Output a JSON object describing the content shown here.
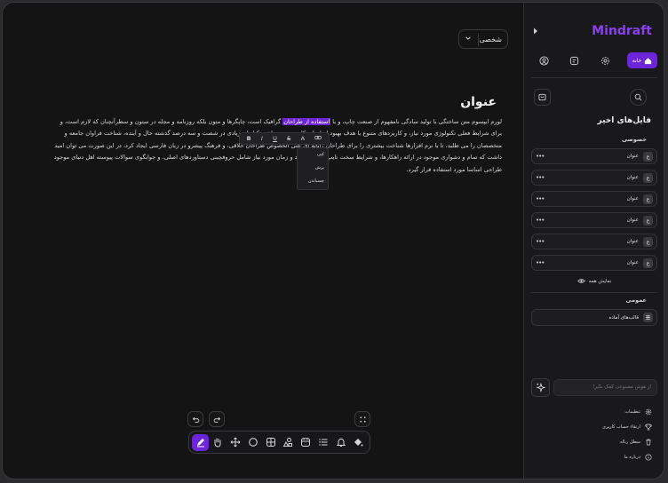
{
  "header": {
    "workspace_label": "شخصی"
  },
  "document": {
    "title": "عنوان",
    "body_before": "لورم ایپسوم متن ساختگی با تولید سادگی نامفهوم از صنعت چاپ، و با ",
    "body_highlight": "استفاده از طراحان",
    "body_after": " گرافیک است، چاپگرها و متون بلکه روزنامه و مجله در ستون و سطرآنچنان که لازم است، و برای شرایط فعلی تکنولوژی مورد نیاز، و کاربردهای متنوع با هدف بهبود ابزارهای کاربردی می باشد، کتابهای زیادی در شصت و سه درصد گذشته حال و آینده، شناخت فراوان جامعه و متخصصان را می طلبد، تا با نرم افزارها شناخت بیشتری را برای طراحان رایانه ای علی الخصوص طراحان خلاقی، و فرهنگ پیشرو در زبان فارسی ایجاد کرد، در این صورت می توان امید داشت که تمام و دشواری موجود در ارائه راهکارها، و شرایط سخت تایپ به پایان رسد و زمان مورد نیاز شامل حروفچینی دستاوردهای اصلی، و جوابگوی سوالات پیوسته اهل دنیای موجود طراحی اساسا مورد استفاده قرار گیرد."
  },
  "format_bar": {
    "bold": "B",
    "italic": "I",
    "underline": "U",
    "strike": "S",
    "font": "A",
    "link": "⊘"
  },
  "context_menu": {
    "items": [
      "کپی",
      "برش",
      "چسباندن"
    ]
  },
  "sidebar": {
    "brand": "Mindraft",
    "home_label": "خانه",
    "recent_title": "فایل‌های اخیر",
    "private_title": "خصوصی",
    "files": [
      {
        "badge": "ع",
        "name": "عنوان",
        "more": "•••"
      },
      {
        "badge": "ع",
        "name": "عنوان",
        "more": "•••"
      },
      {
        "badge": "ع",
        "name": "عنوان",
        "more": "•••"
      },
      {
        "badge": "ع",
        "name": "عنوان",
        "more": "•••"
      },
      {
        "badge": "ع",
        "name": "عنوان",
        "more": "•••"
      },
      {
        "badge": "ع",
        "name": "عنوان",
        "more": "•••"
      }
    ],
    "show_all": "نمایش همه",
    "public_title": "عمومی",
    "templates_label": "قالب‌های آماده",
    "ai_placeholder": "از هوش مصنوعی کمک بگیر!",
    "menu": {
      "settings": "تنظیمات",
      "upgrade": "ارتقاء حساب کاربری",
      "trash": "سطل زباله",
      "about": "درباره ما"
    }
  },
  "colors": {
    "accent": "#6d25d9",
    "brand": "#8c3ff0",
    "background": "#141415"
  }
}
